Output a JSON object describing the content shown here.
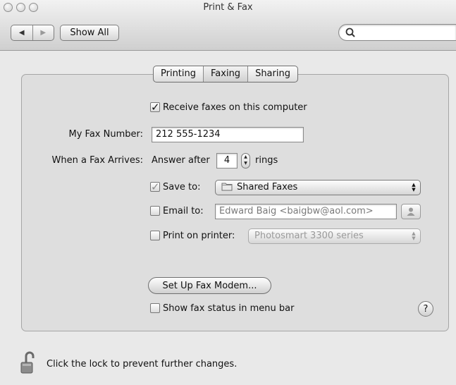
{
  "window": {
    "title": "Print & Fax"
  },
  "toolbar": {
    "back_icon": "back-arrow",
    "forward_icon": "forward-arrow",
    "show_all_label": "Show All",
    "search_placeholder": ""
  },
  "tabs": [
    {
      "label": "Printing",
      "active": false
    },
    {
      "label": "Faxing",
      "active": true
    },
    {
      "label": "Sharing",
      "active": false
    }
  ],
  "faxing": {
    "receive_label": "Receive faxes on this computer",
    "receive_checked": true,
    "fax_number_label": "My Fax Number:",
    "fax_number_value": "212 555-1234",
    "arrives_label": "When a Fax Arrives:",
    "answer_prefix": "Answer after",
    "rings_value": "4",
    "rings_suffix": "rings",
    "save_to_label": "Save to:",
    "save_to_checked": true,
    "save_to_value": "Shared Faxes",
    "email_label": "Email to:",
    "email_checked": false,
    "email_value": "Edward Baig <baigbw@aol.com>",
    "print_label": "Print on printer:",
    "print_checked": false,
    "print_value": "Photosmart 3300 series",
    "setup_modem_label": "Set Up Fax Modem...",
    "menu_status_label": "Show fax status in menu bar",
    "menu_status_checked": false,
    "help_label": "?"
  },
  "footer": {
    "lock_text": "Click the lock to prevent further changes."
  }
}
